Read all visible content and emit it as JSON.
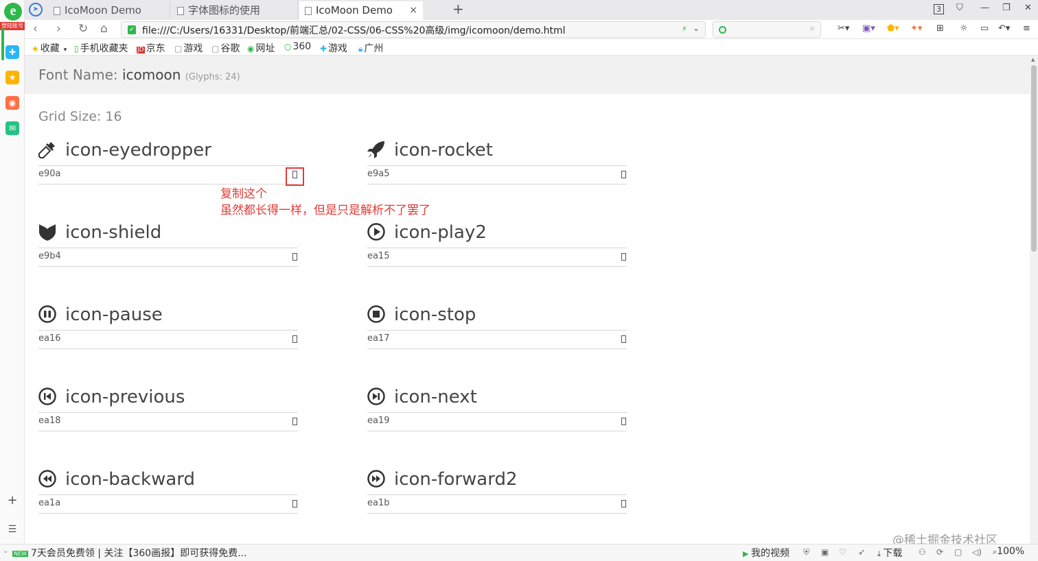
{
  "browser": {
    "logo_tag": "登陆账号",
    "tabs": [
      {
        "label": "IcoMoon Demo",
        "active": false
      },
      {
        "label": "字体图标的使用",
        "active": false
      },
      {
        "label": "IcoMoon Demo",
        "active": true
      }
    ],
    "tab_close": "×",
    "new_tab": "+",
    "tab_count": "3",
    "address": "file:///C:/Users/16331/Desktop/前端汇总/02-CSS/06-CSS%20高级/img/icomoon/demo.html",
    "bookmarks": [
      {
        "label": "收藏",
        "icon": "star-icon"
      },
      {
        "label": "手机收藏夹",
        "icon": "phone-icon"
      },
      {
        "label": "京东",
        "icon": "jd-icon"
      },
      {
        "label": "游戏",
        "icon": "doc-icon"
      },
      {
        "label": "谷歌",
        "icon": "doc-icon"
      },
      {
        "label": "网址",
        "icon": "globe-icon"
      },
      {
        "label": "360",
        "icon": "360-icon"
      },
      {
        "label": "游戏",
        "icon": "game-icon"
      },
      {
        "label": "广州",
        "icon": "lock-icon"
      }
    ]
  },
  "page": {
    "font_name_label": "Font Name:",
    "font_name": "icomoon",
    "glyph_count": "(Glyphs: 24)",
    "grid_size": "Grid Size: 16",
    "glyphs": [
      {
        "name": "icon-eyedropper",
        "code": "e90a",
        "icon": "eyedropper-icon"
      },
      {
        "name": "icon-rocket",
        "code": "e9a5",
        "icon": "rocket-icon"
      },
      {
        "name": "icon-shield",
        "code": "e9b4",
        "icon": "shield-icon"
      },
      {
        "name": "icon-play2",
        "code": "ea15",
        "icon": "play-icon"
      },
      {
        "name": "icon-pause",
        "code": "ea16",
        "icon": "pause-icon"
      },
      {
        "name": "icon-stop",
        "code": "ea17",
        "icon": "stop-icon"
      },
      {
        "name": "icon-previous",
        "code": "ea18",
        "icon": "previous-icon"
      },
      {
        "name": "icon-next",
        "code": "ea19",
        "icon": "next-icon"
      },
      {
        "name": "icon-backward",
        "code": "ea1a",
        "icon": "backward-icon"
      },
      {
        "name": "icon-forward2",
        "code": "ea1b",
        "icon": "forward-icon"
      }
    ],
    "annotation_line1": "复制这个",
    "annotation_line2": "虽然都长得一样，但是只是解析不了罢了"
  },
  "statusbar": {
    "news_tag": "NEW",
    "news": "7天会员免费领 | 关注【360画报】即可获得免费...",
    "my_video": "我的视频",
    "download": "下载",
    "zoom": "100%"
  },
  "watermark": "@稀土掘金技术社区",
  "colors": {
    "accent_green": "#2db84a",
    "annotation_red": "#e53935",
    "header_bg": "#f1f1f1"
  }
}
